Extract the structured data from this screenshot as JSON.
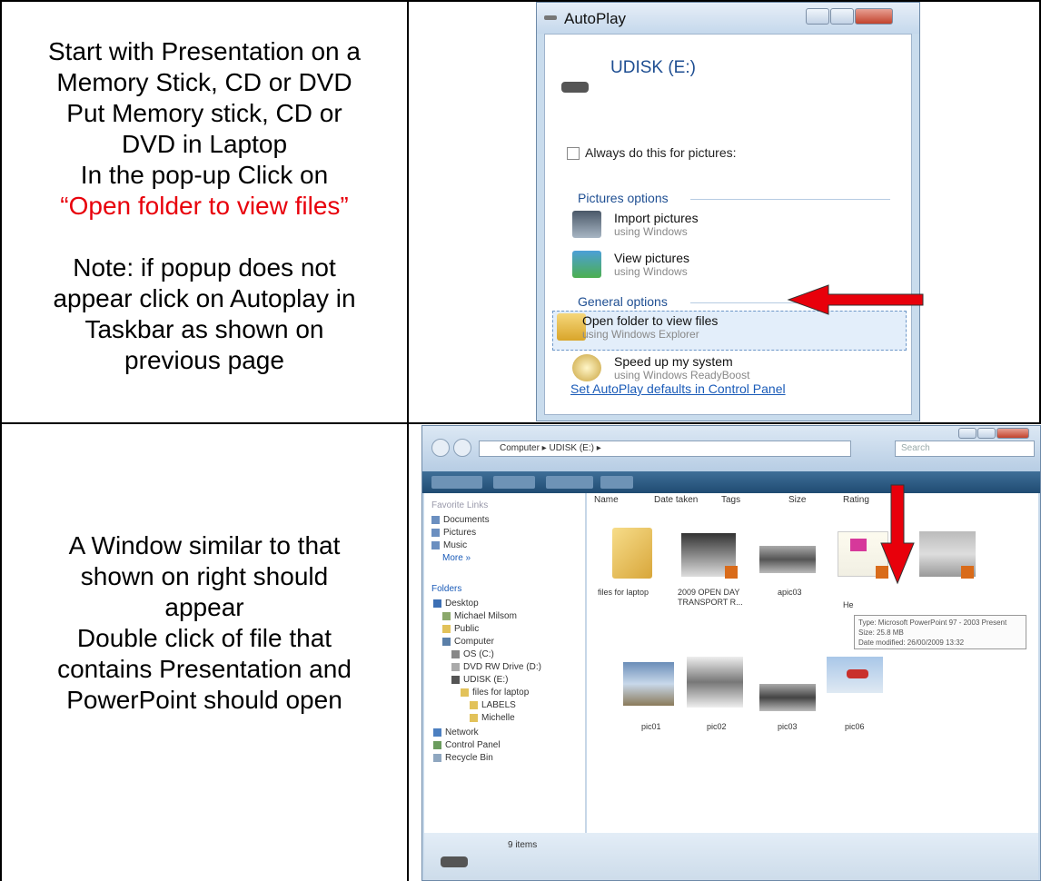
{
  "step1": {
    "line1": "Start with Presentation on a",
    "line2": "Memory Stick, CD or DVD",
    "line3": "Put Memory stick, CD or",
    "line4": "DVD in Laptop",
    "line5": "In the pop-up Click on",
    "highlight": "“Open folder to view files”",
    "note1": "Note: if popup does not",
    "note2": "appear click on Autoplay in",
    "note3": "Taskbar as shown on",
    "note4": "previous page"
  },
  "step2": {
    "line1": "A Window similar to that",
    "line2": "shown on right should",
    "line3": "appear",
    "line4": "Double click of file that",
    "line5": "contains Presentation and",
    "line6": "PowerPoint should open"
  },
  "autoplay": {
    "title": "AutoPlay",
    "drive": "UDISK (E:)",
    "always": "Always do this for pictures:",
    "pictures_section": "Pictures options",
    "general_section": "General options",
    "items": [
      {
        "title": "Import pictures",
        "sub": "using Windows"
      },
      {
        "title": "View pictures",
        "sub": "using Windows"
      },
      {
        "title": "Open folder to view files",
        "sub": "using Windows Explorer"
      },
      {
        "title": "Speed up my system",
        "sub": "using Windows ReadyBoost"
      }
    ],
    "link": "Set AutoPlay defaults in Control Panel",
    "highlight_color": "#e3eefa"
  },
  "explorer": {
    "address": "Computer ▸ UDISK (E:) ▸",
    "search": "Search",
    "columns": [
      "Name",
      "Date taken",
      "Tags",
      "Size",
      "Rating"
    ],
    "favorites_title": "Favorite Links",
    "favorites": [
      "Documents",
      "Pictures",
      "Music",
      "More »"
    ],
    "folders_title": "Folders",
    "tree": [
      "Desktop",
      "Michael Milsom",
      "Public",
      "Computer",
      "OS (C:)",
      "DVD RW Drive (D:)",
      "UDISK (E:)",
      "files for laptop",
      "LABELS",
      "Michelle",
      "Network",
      "Control Panel",
      "Recycle Bin"
    ],
    "files": [
      {
        "name": "files for laptop",
        "sub": ""
      },
      {
        "name": "2009 OPEN DAY",
        "sub": "TRANSPORT R..."
      },
      {
        "name": "apic03",
        "sub": ""
      },
      {
        "name": "He",
        "sub": ""
      },
      {
        "name": "",
        "sub": ""
      },
      {
        "name": "pic01",
        "sub": ""
      },
      {
        "name": "pic02",
        "sub": ""
      },
      {
        "name": "pic03",
        "sub": ""
      },
      {
        "name": "pic06",
        "sub": ""
      }
    ],
    "tooltip_lines": [
      "Type: Microsoft PowerPoint 97 - 2003 Present",
      "Size: 25.8 MB",
      "Date modified: 26/00/2009 13:32"
    ],
    "status": "9 items"
  }
}
